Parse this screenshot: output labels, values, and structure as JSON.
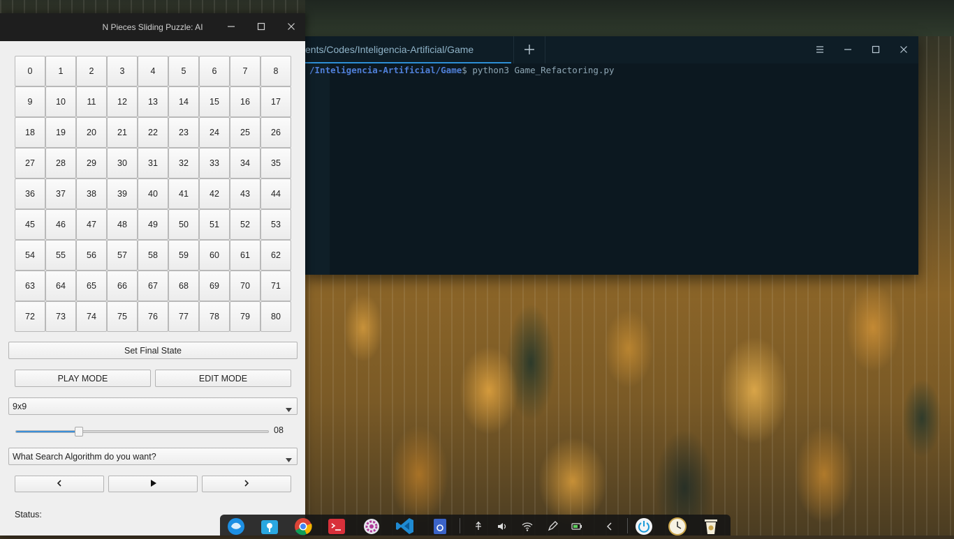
{
  "app": {
    "title": "N Pieces Sliding Puzzle: AI",
    "tiles": [
      "0",
      "1",
      "2",
      "3",
      "4",
      "5",
      "6",
      "7",
      "8",
      "9",
      "10",
      "11",
      "12",
      "13",
      "14",
      "15",
      "16",
      "17",
      "18",
      "19",
      "20",
      "21",
      "22",
      "23",
      "24",
      "25",
      "26",
      "27",
      "28",
      "29",
      "30",
      "31",
      "32",
      "33",
      "34",
      "35",
      "36",
      "37",
      "38",
      "39",
      "40",
      "41",
      "42",
      "43",
      "44",
      "45",
      "46",
      "47",
      "48",
      "49",
      "50",
      "51",
      "52",
      "53",
      "54",
      "55",
      "56",
      "57",
      "58",
      "59",
      "60",
      "61",
      "62",
      "63",
      "64",
      "65",
      "66",
      "67",
      "68",
      "69",
      "70",
      "71",
      "72",
      "73",
      "74",
      "75",
      "76",
      "77",
      "78",
      "79",
      "80"
    ],
    "set_final_state_label": "Set Final State",
    "play_mode_label": "PLAY MODE",
    "edit_mode_label": "EDIT MODE",
    "size_select_value": "9x9",
    "speed_slider": {
      "value_text": "08",
      "fill_fraction": 0.25
    },
    "algorithm_select_placeholder": "What Search Algorithm do you want?",
    "nav": {
      "prev_icon": "chevron-left-icon",
      "play_icon": "play-icon",
      "next_icon": "chevron-right-icon"
    },
    "status_label": "Status:"
  },
  "terminal": {
    "tab_title": "ents/Codes/Inteligencia-Artificial/Game",
    "prompt_path": "/Inteligencia-Artificial/Game",
    "prompt_symbol": "$",
    "command": "python3 Game_Refactoring.py"
  },
  "dock": {
    "apps": [
      "deepin-launcher-icon",
      "file-manager-icon",
      "chrome-icon",
      "terminal-icon",
      "settings-icon",
      "vscode-icon",
      "app-store-icon"
    ],
    "tray": [
      "usb-icon",
      "volume-icon",
      "wifi-icon",
      "pen-icon",
      "battery-icon",
      "collapse-arrow-icon"
    ],
    "system": [
      "power-icon",
      "clock-icon",
      "trash-icon"
    ]
  },
  "colors": {
    "accent": "#3b8fd9",
    "terminal_bg": "#0c1820",
    "terminal_path": "#4f7fd8",
    "app_titlebar": "#1e1e1e"
  }
}
